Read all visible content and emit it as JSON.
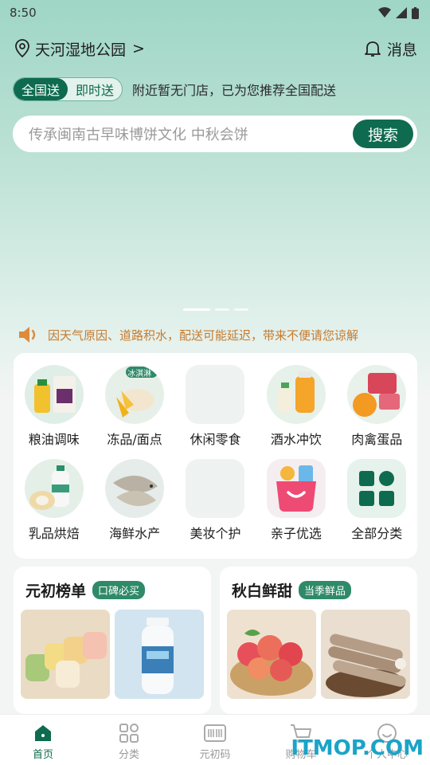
{
  "status_bar": {
    "time": "8:50"
  },
  "location": {
    "name": "天河湿地公园",
    "chevron": ">",
    "message_label": "消息"
  },
  "delivery": {
    "mode_active": "全国送",
    "mode_inactive": "即时送",
    "note": "附近暂无门店，已为您推荐全国配送"
  },
  "search": {
    "placeholder": "传承闽南古早味博饼文化 中秋会饼",
    "button": "搜索"
  },
  "notice": {
    "text": "因天气原因、道路积水，配送可能延迟，带来不便请您谅解"
  },
  "categories": [
    {
      "label": "粮油调味",
      "icon": "grain-oil-icon"
    },
    {
      "label": "冻品/面点",
      "icon": "frozen-food-icon",
      "badge": "冰淇淋"
    },
    {
      "label": "休闲零食",
      "icon": "snack-icon"
    },
    {
      "label": "酒水冲饮",
      "icon": "drinks-icon"
    },
    {
      "label": "肉禽蛋品",
      "icon": "meat-egg-icon"
    },
    {
      "label": "乳品烘焙",
      "icon": "dairy-bakery-icon"
    },
    {
      "label": "海鲜水产",
      "icon": "seafood-icon"
    },
    {
      "label": "美妆个护",
      "icon": "beauty-icon"
    },
    {
      "label": "亲子优选",
      "icon": "kids-bag-icon"
    },
    {
      "label": "全部分类",
      "icon": "all-categories-icon"
    }
  ],
  "cards": [
    {
      "title": "元初榜单",
      "tag": "口碑必买"
    },
    {
      "title": "秋白鲜甜",
      "tag": "当季鲜品"
    }
  ],
  "tabs": [
    {
      "label": "首页",
      "icon": "home-icon"
    },
    {
      "label": "分类",
      "icon": "grid-icon"
    },
    {
      "label": "元初码",
      "icon": "barcode-icon"
    },
    {
      "label": "购物车",
      "icon": "cart-icon"
    },
    {
      "label": "个人中心",
      "icon": "profile-icon"
    }
  ],
  "watermark": "ITMOP.COM",
  "colors": {
    "brand": "#0e6b4f",
    "notice": "#c77a2e"
  }
}
